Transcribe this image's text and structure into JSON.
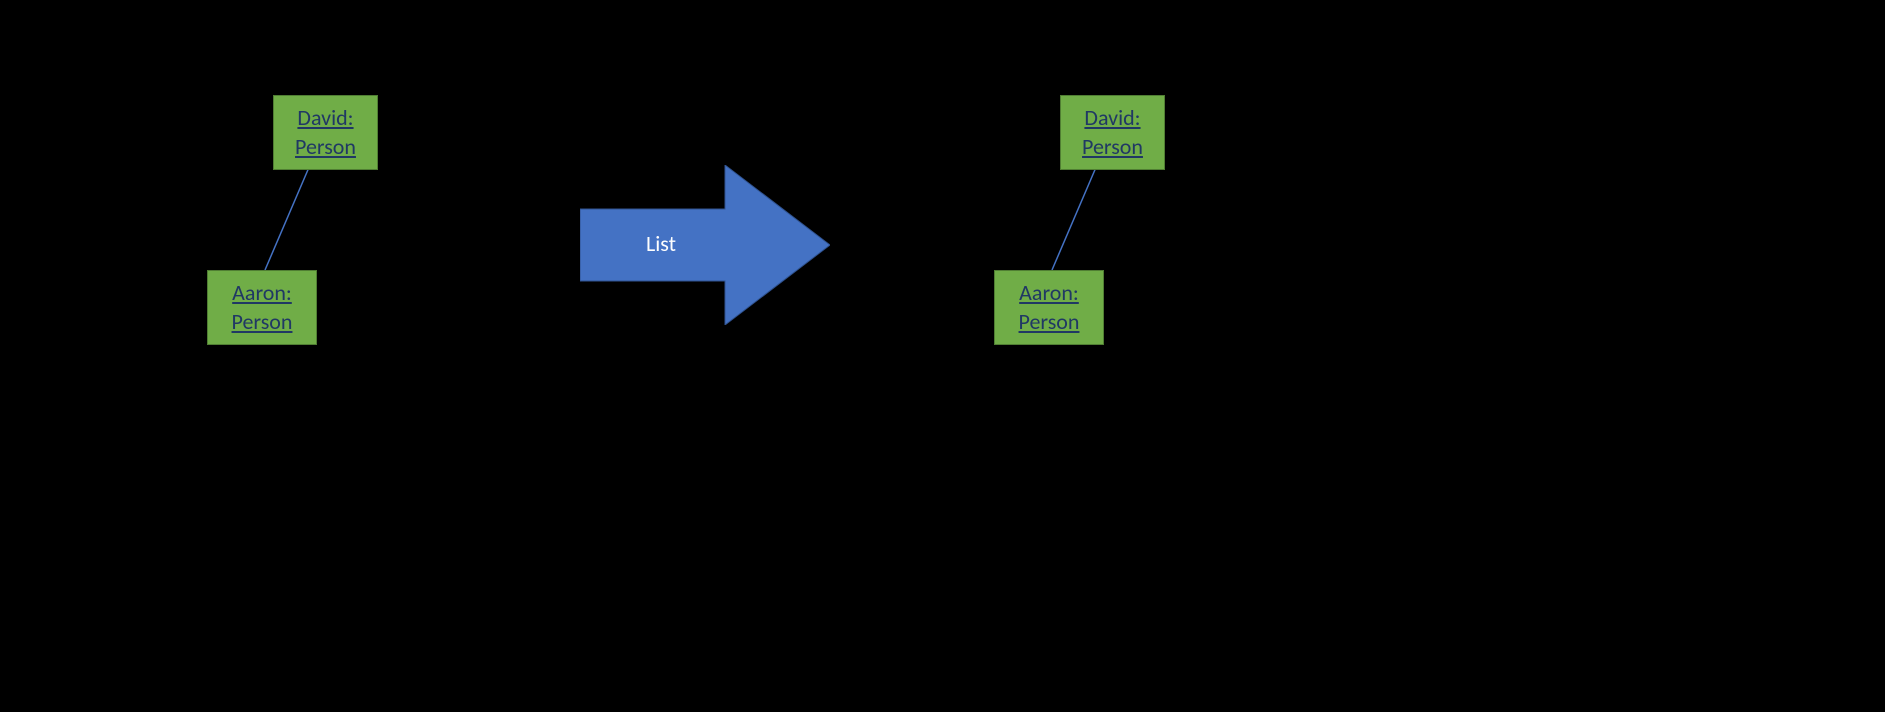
{
  "diagram": {
    "left_group": {
      "top_box": {
        "name": "David:",
        "type": "Person"
      },
      "bottom_box": {
        "name": "Aaron:",
        "type": "Person"
      }
    },
    "right_group": {
      "top_box": {
        "name": "David:",
        "type": "Person"
      },
      "bottom_box": {
        "name": "Aaron:",
        "type": "Person"
      }
    },
    "arrow": {
      "label": "List"
    }
  }
}
